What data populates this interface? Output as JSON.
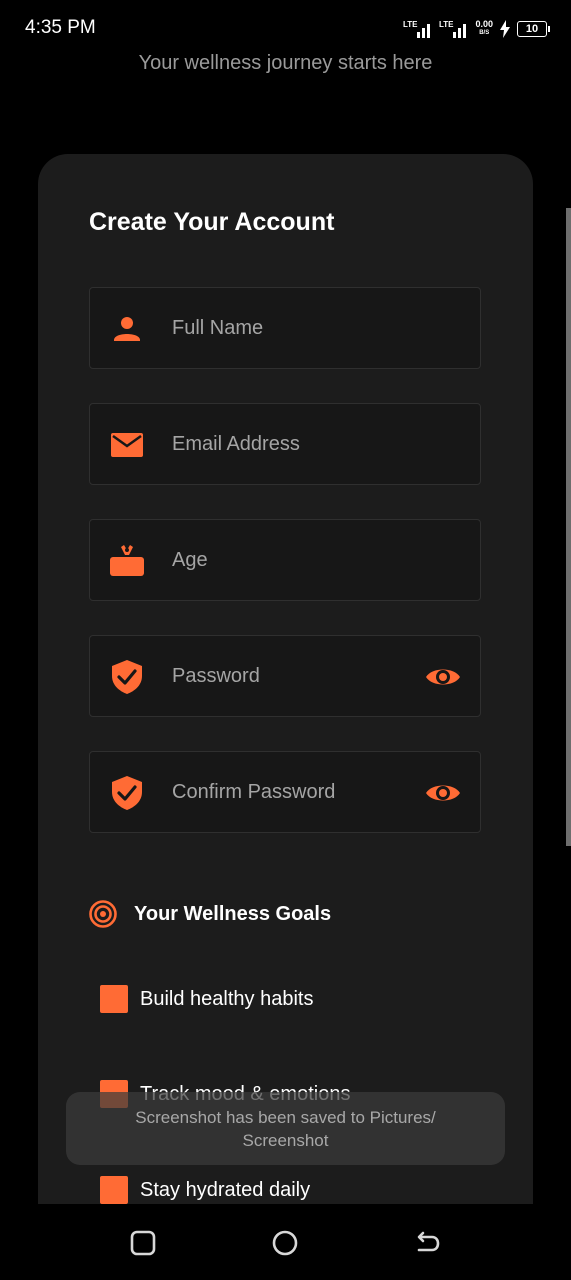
{
  "status": {
    "time": "4:35 PM",
    "net1": "LTE",
    "net2": "LTE",
    "speed": "0.00",
    "speed_unit": "B/S",
    "battery": "10"
  },
  "subtitle": "Your wellness journey starts here",
  "form": {
    "title": "Create Your Account",
    "fields": [
      {
        "placeholder": "Full Name",
        "icon": "person-icon"
      },
      {
        "placeholder": "Email Address",
        "icon": "email-icon"
      },
      {
        "placeholder": "Age",
        "icon": "cake-icon"
      },
      {
        "placeholder": "Password",
        "icon": "shield-check-icon"
      },
      {
        "placeholder": "Confirm Password",
        "icon": "shield-check-icon"
      }
    ]
  },
  "goals": {
    "title": "Your Wellness Goals",
    "items": [
      {
        "label": "Build healthy habits"
      },
      {
        "label": "Track mood & emotions"
      },
      {
        "label": "Stay hydrated daily"
      }
    ]
  },
  "toast": {
    "line1": "Screenshot has been saved to  Pictures/",
    "line2": "Screenshot"
  },
  "colors": {
    "accent": "#ff6b35",
    "card": "#1c1c1c",
    "background": "#000000"
  }
}
